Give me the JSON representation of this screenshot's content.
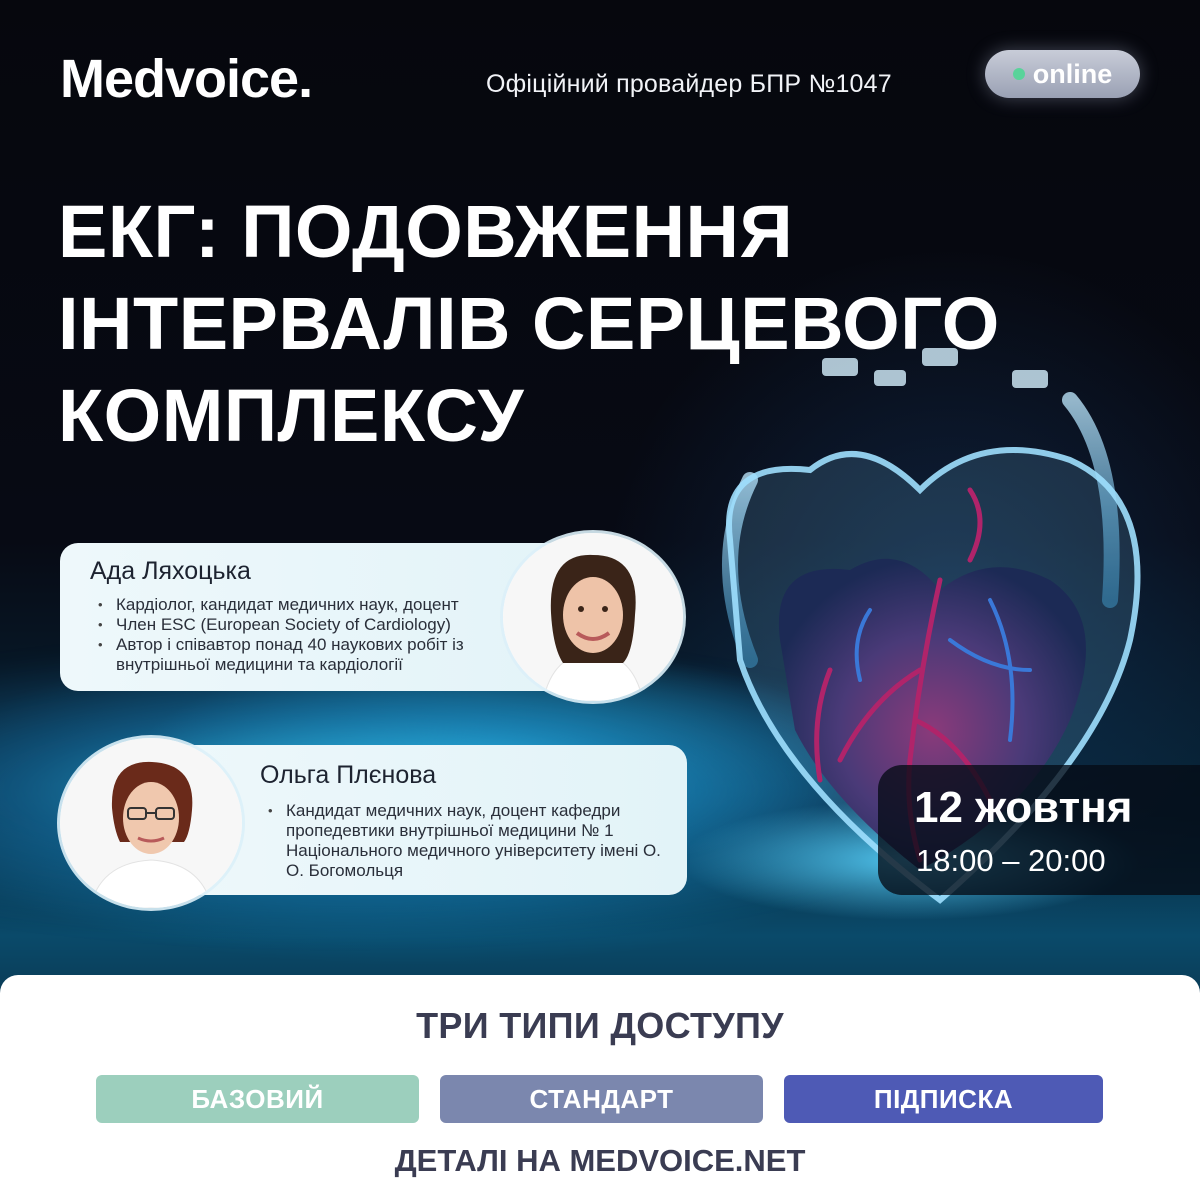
{
  "header": {
    "logo": "Medvoice",
    "logo_dot": ".",
    "provider": "Офіційний провайдер БПР №1047",
    "online_badge": "online"
  },
  "title": {
    "lines": [
      "ЕКГ: ПОДОВЖЕННЯ",
      "ІНТЕРВАЛІВ СЕРЦЕВОГО",
      "КОМПЛЕКСУ"
    ]
  },
  "speakers": [
    {
      "name": "Ада Ляхоцька",
      "bullets": [
        "Кардіолог, кандидат медичних наук, доцент",
        "Член ESC (European Society of Cardiology)",
        "Автор і співавтор понад 40 наукових робіт із внутрішньої медицини та кардіології"
      ]
    },
    {
      "name": "Ольга Плєнова",
      "bullets": [
        "Кандидат медичних наук, доцент кафедри пропедевтики внутрішньої медицини № 1 Національного медичного університету імені О. О. Богомольця"
      ]
    }
  ],
  "event": {
    "date": "12 жовтня",
    "time": "18:00 – 20:00"
  },
  "access": {
    "title": "ТРИ ТИПИ ДОСТУПУ",
    "tiers": [
      "БАЗОВИЙ",
      "СТАНДАРТ",
      "ПІДПИСКА"
    ],
    "details": "ДЕТАЛІ НА MEDVOICE.NET"
  },
  "colors": {
    "tier_basic": "#9ccfbd",
    "tier_standard": "#7b87ae",
    "tier_subscription": "#4e5ab5",
    "online_dot": "#59d39a"
  }
}
